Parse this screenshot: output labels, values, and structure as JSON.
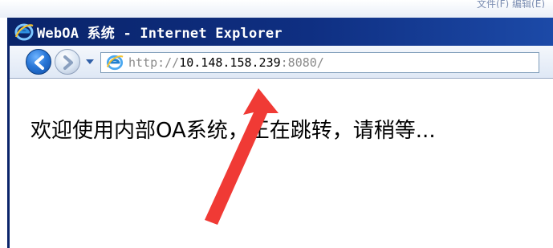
{
  "desktop": {
    "ghost_text": "文件(F)  编辑(E)"
  },
  "window": {
    "title": "WebOA 系统 - Internet Explorer",
    "title_bar_color": "#0a246a"
  },
  "toolbar": {
    "back_icon": "back-arrow-icon",
    "forward_icon": "forward-arrow-icon",
    "history_icon": "chevron-down-icon"
  },
  "address_bar": {
    "scheme": "http://",
    "host": "10.148.158.239",
    "port_path": ":8080/"
  },
  "page": {
    "message": "欢迎使用内部OA系统，正在跳转，请稍等..."
  },
  "annotation": {
    "color": "#f03a35"
  }
}
